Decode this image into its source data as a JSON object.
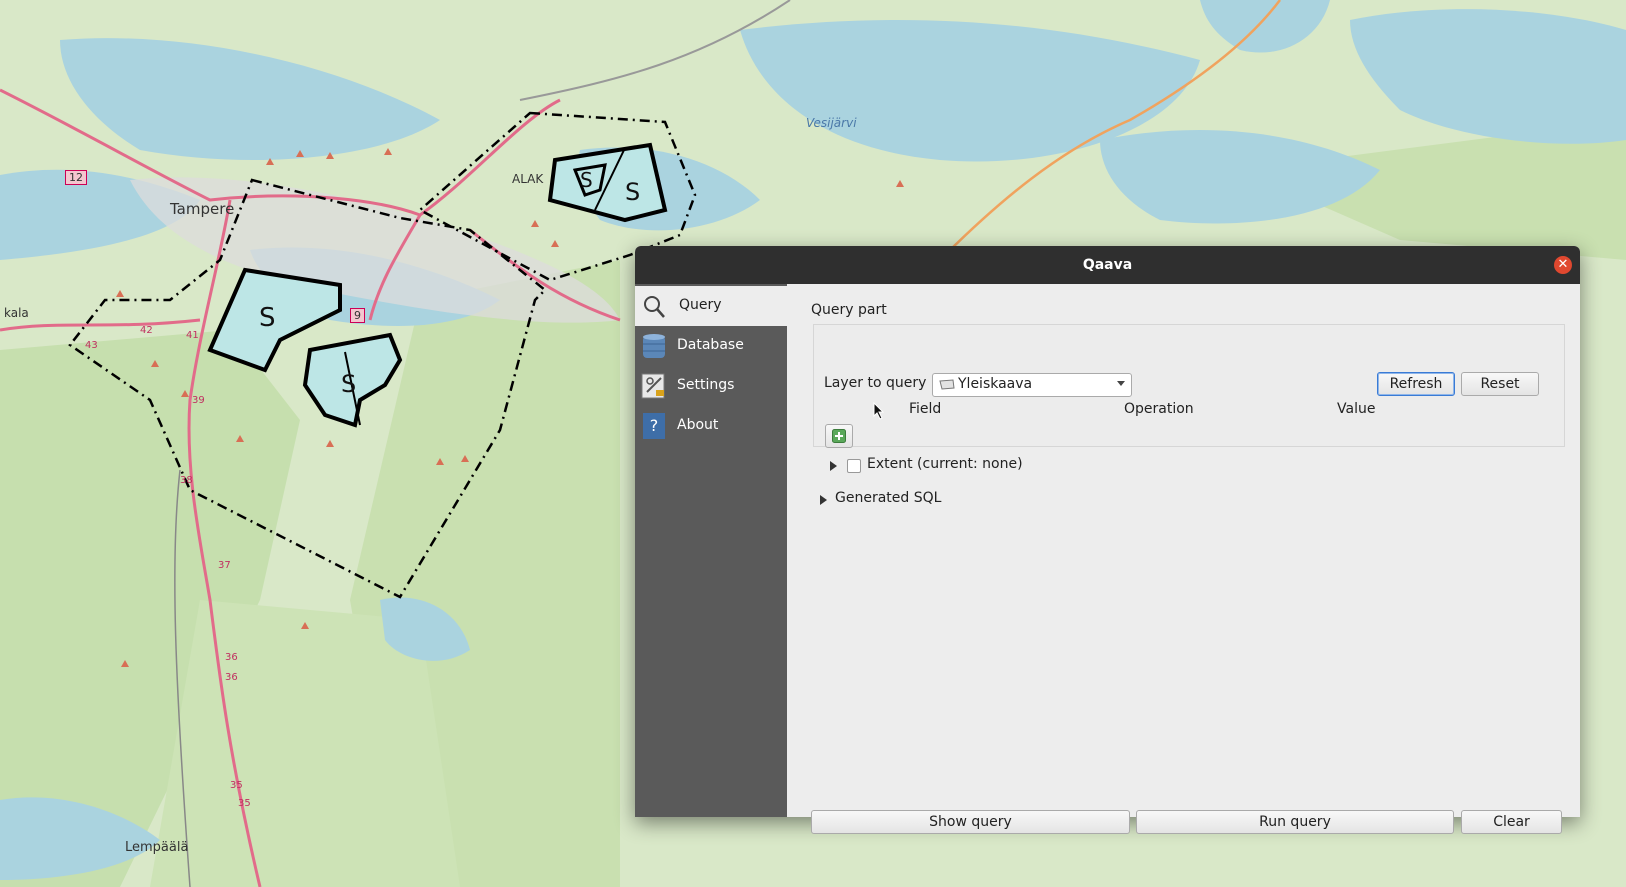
{
  "map": {
    "labels": {
      "tampere": "Tampere",
      "kala": "kala",
      "alak": "ALAK",
      "vesijarvi": "Vesijärvi",
      "lempaala": "Lempäälä",
      "road_12": "12",
      "road_9": "9",
      "road_42": "42",
      "road_41": "41",
      "road_43": "43",
      "road_39": "39",
      "road_38": "38",
      "road_37": "37",
      "road_36a": "36",
      "road_36b": "36",
      "road_35a": "35",
      "road_35b": "35"
    },
    "zone_symbol": "S",
    "colors": {
      "water": "#aad3df",
      "forest": "#c8dfb3",
      "zone_fill": "#bde6e6",
      "road": "#e26b8a"
    }
  },
  "dialog": {
    "title": "Qaava",
    "close_icon": "close-icon",
    "sidebar": [
      {
        "label": "Query",
        "icon": "search-icon",
        "active": true
      },
      {
        "label": "Database",
        "icon": "database-icon",
        "active": false
      },
      {
        "label": "Settings",
        "icon": "settings-icon",
        "active": false
      },
      {
        "label": "About",
        "icon": "help-icon",
        "active": false
      }
    ],
    "query_part": {
      "heading": "Query part",
      "layer_label": "Layer to query",
      "layer_value": "Yleiskaava",
      "refresh_label": "Refresh",
      "reset_label": "Reset",
      "columns": [
        "Field",
        "Operation",
        "Value"
      ],
      "extent_label": "Extent (current: none)",
      "extent_checked": false
    },
    "generated_sql_label": "Generated SQL",
    "buttons": {
      "show_query": "Show query",
      "run_query": "Run query",
      "clear": "Clear"
    }
  }
}
